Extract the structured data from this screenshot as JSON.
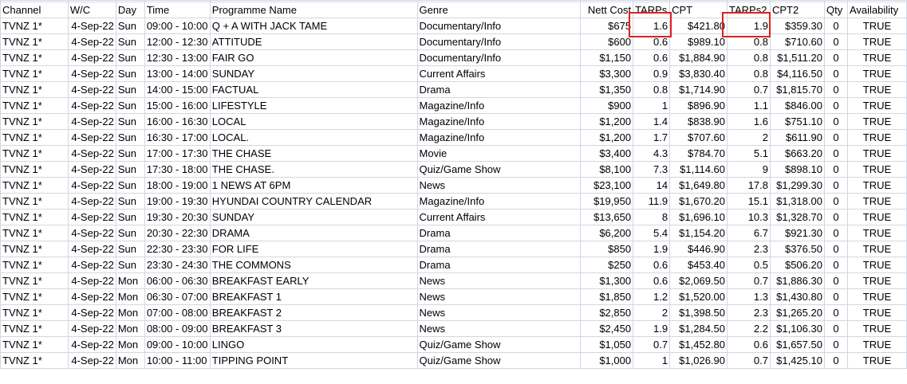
{
  "columns": [
    "Channel",
    "W/C",
    "Day",
    "Time",
    "Programme Name",
    "Genre",
    "Nett Cost",
    "TARPs",
    "CPT",
    "TARPs2",
    "CPT2",
    "Qty",
    "Availability"
  ],
  "highlighted_columns": [
    "TARPs",
    "TARPs2"
  ],
  "highlight_color": "#e0201e",
  "rows": [
    [
      "TVNZ 1*",
      "4-Sep-22",
      "Sun",
      "09:00 - 10:00",
      "Q + A WITH JACK TAME",
      "Documentary/Info",
      "$675",
      "1.6",
      "$421.80",
      "1.9",
      "$359.30",
      "0",
      "TRUE"
    ],
    [
      "TVNZ 1*",
      "4-Sep-22",
      "Sun",
      "12:00 - 12:30",
      "ATTITUDE",
      "Documentary/Info",
      "$600",
      "0.6",
      "$989.10",
      "0.8",
      "$710.60",
      "0",
      "TRUE"
    ],
    [
      "TVNZ 1*",
      "4-Sep-22",
      "Sun",
      "12:30 - 13:00",
      "FAIR GO",
      "Documentary/Info",
      "$1,150",
      "0.6",
      "$1,884.90",
      "0.8",
      "$1,511.20",
      "0",
      "TRUE"
    ],
    [
      "TVNZ 1*",
      "4-Sep-22",
      "Sun",
      "13:00 - 14:00",
      "SUNDAY",
      "Current Affairs",
      "$3,300",
      "0.9",
      "$3,830.40",
      "0.8",
      "$4,116.50",
      "0",
      "TRUE"
    ],
    [
      "TVNZ 1*",
      "4-Sep-22",
      "Sun",
      "14:00 - 15:00",
      "FACTUAL",
      "Drama",
      "$1,350",
      "0.8",
      "$1,714.90",
      "0.7",
      "$1,815.70",
      "0",
      "TRUE"
    ],
    [
      "TVNZ 1*",
      "4-Sep-22",
      "Sun",
      "15:00 - 16:00",
      "LIFESTYLE",
      "Magazine/Info",
      "$900",
      "1",
      "$896.90",
      "1.1",
      "$846.00",
      "0",
      "TRUE"
    ],
    [
      "TVNZ 1*",
      "4-Sep-22",
      "Sun",
      "16:00 - 16:30",
      "LOCAL",
      "Magazine/Info",
      "$1,200",
      "1.4",
      "$838.90",
      "1.6",
      "$751.10",
      "0",
      "TRUE"
    ],
    [
      "TVNZ 1*",
      "4-Sep-22",
      "Sun",
      "16:30 - 17:00",
      "LOCAL.",
      "Magazine/Info",
      "$1,200",
      "1.7",
      "$707.60",
      "2",
      "$611.90",
      "0",
      "TRUE"
    ],
    [
      "TVNZ 1*",
      "4-Sep-22",
      "Sun",
      "17:00 - 17:30",
      "THE CHASE",
      "Movie",
      "$3,400",
      "4.3",
      "$784.70",
      "5.1",
      "$663.20",
      "0",
      "TRUE"
    ],
    [
      "TVNZ 1*",
      "4-Sep-22",
      "Sun",
      "17:30 - 18:00",
      "THE CHASE.",
      "Quiz/Game Show",
      "$8,100",
      "7.3",
      "$1,114.60",
      "9",
      "$898.10",
      "0",
      "TRUE"
    ],
    [
      "TVNZ 1*",
      "4-Sep-22",
      "Sun",
      "18:00 - 19:00",
      "1 NEWS AT 6PM",
      "News",
      "$23,100",
      "14",
      "$1,649.80",
      "17.8",
      "$1,299.30",
      "0",
      "TRUE"
    ],
    [
      "TVNZ 1*",
      "4-Sep-22",
      "Sun",
      "19:00 - 19:30",
      "HYUNDAI COUNTRY CALENDAR",
      "Magazine/Info",
      "$19,950",
      "11.9",
      "$1,670.20",
      "15.1",
      "$1,318.00",
      "0",
      "TRUE"
    ],
    [
      "TVNZ 1*",
      "4-Sep-22",
      "Sun",
      "19:30 - 20:30",
      "SUNDAY",
      "Current Affairs",
      "$13,650",
      "8",
      "$1,696.10",
      "10.3",
      "$1,328.70",
      "0",
      "TRUE"
    ],
    [
      "TVNZ 1*",
      "4-Sep-22",
      "Sun",
      "20:30 - 22:30",
      "DRAMA",
      "Drama",
      "$6,200",
      "5.4",
      "$1,154.20",
      "6.7",
      "$921.30",
      "0",
      "TRUE"
    ],
    [
      "TVNZ 1*",
      "4-Sep-22",
      "Sun",
      "22:30 - 23:30",
      "FOR LIFE",
      "Drama",
      "$850",
      "1.9",
      "$446.90",
      "2.3",
      "$376.50",
      "0",
      "TRUE"
    ],
    [
      "TVNZ 1*",
      "4-Sep-22",
      "Sun",
      "23:30 - 24:30",
      "THE COMMONS",
      "Drama",
      "$250",
      "0.6",
      "$453.40",
      "0.5",
      "$506.20",
      "0",
      "TRUE"
    ],
    [
      "TVNZ 1*",
      "4-Sep-22",
      "Mon",
      "06:00 - 06:30",
      "BREAKFAST EARLY",
      "News",
      "$1,300",
      "0.6",
      "$2,069.50",
      "0.7",
      "$1,886.30",
      "0",
      "TRUE"
    ],
    [
      "TVNZ 1*",
      "4-Sep-22",
      "Mon",
      "06:30 - 07:00",
      "BREAKFAST 1",
      "News",
      "$1,850",
      "1.2",
      "$1,520.00",
      "1.3",
      "$1,430.80",
      "0",
      "TRUE"
    ],
    [
      "TVNZ 1*",
      "4-Sep-22",
      "Mon",
      "07:00 - 08:00",
      "BREAKFAST 2",
      "News",
      "$2,850",
      "2",
      "$1,398.50",
      "2.3",
      "$1,265.20",
      "0",
      "TRUE"
    ],
    [
      "TVNZ 1*",
      "4-Sep-22",
      "Mon",
      "08:00 - 09:00",
      "BREAKFAST 3",
      "News",
      "$2,450",
      "1.9",
      "$1,284.50",
      "2.2",
      "$1,106.30",
      "0",
      "TRUE"
    ],
    [
      "TVNZ 1*",
      "4-Sep-22",
      "Mon",
      "09:00 - 10:00",
      "LINGO",
      "Quiz/Game Show",
      "$1,050",
      "0.7",
      "$1,452.80",
      "0.6",
      "$1,657.50",
      "0",
      "TRUE"
    ],
    [
      "TVNZ 1*",
      "4-Sep-22",
      "Mon",
      "10:00 - 11:00",
      "TIPPING POINT",
      "Quiz/Game Show",
      "$1,000",
      "1",
      "$1,026.90",
      "0.7",
      "$1,425.10",
      "0",
      "TRUE"
    ]
  ]
}
